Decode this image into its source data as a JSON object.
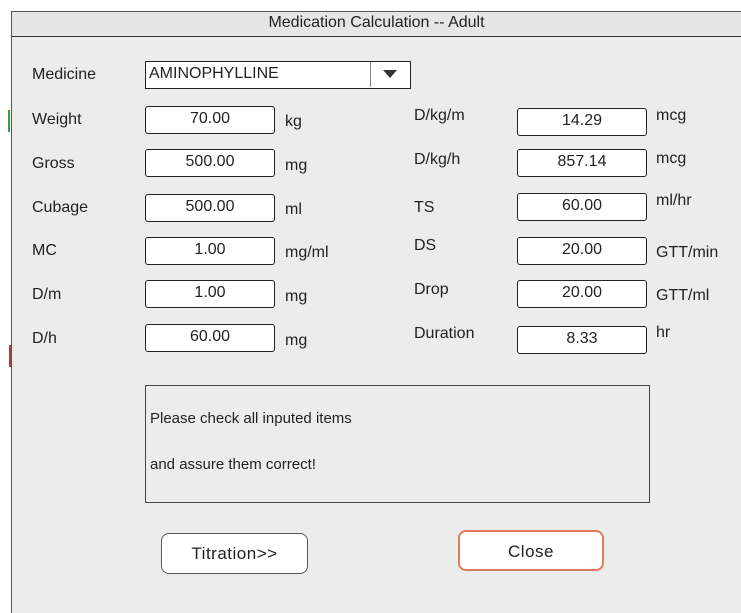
{
  "dialog": {
    "title": "Medication Calculation -- Adult"
  },
  "left_fields": {
    "medicine": {
      "label": "Medicine",
      "value": "AMINOPHYLLINE"
    },
    "weight": {
      "label": "Weight",
      "value": "70.00",
      "unit": "kg"
    },
    "gross": {
      "label": "Gross",
      "value": "500.00",
      "unit": "mg"
    },
    "cubage": {
      "label": "Cubage",
      "value": "500.00",
      "unit": "ml"
    },
    "mc": {
      "label": "MC",
      "value": "1.00",
      "unit": "mg/ml"
    },
    "dm": {
      "label": "D/m",
      "value": "1.00",
      "unit": "mg"
    },
    "dh": {
      "label": "D/h",
      "value": "60.00",
      "unit": "mg"
    }
  },
  "right_fields": {
    "dkgm": {
      "label": "D/kg/m",
      "value": "14.29",
      "unit": "mcg"
    },
    "dkgh": {
      "label": "D/kg/h",
      "value": "857.14",
      "unit": "mcg"
    },
    "ts": {
      "label": "TS",
      "value": "60.00",
      "unit": "ml/hr"
    },
    "ds": {
      "label": "DS",
      "value": "20.00",
      "unit": "GTT/min"
    },
    "drop": {
      "label": "Drop",
      "value": "20.00",
      "unit": "GTT/ml"
    },
    "duration": {
      "label": "Duration",
      "value": "8.33",
      "unit": "hr"
    }
  },
  "message": {
    "line1": "Please check all inputed items",
    "line2": "and assure them correct!"
  },
  "buttons": {
    "titration": "Titration>>",
    "close": "Close"
  },
  "icons": {
    "dropdown": "chevron-down-icon"
  },
  "colors": {
    "close_border": "#e07a5a",
    "marker_green": "#2e9e3e",
    "marker_red": "#c0392b"
  }
}
